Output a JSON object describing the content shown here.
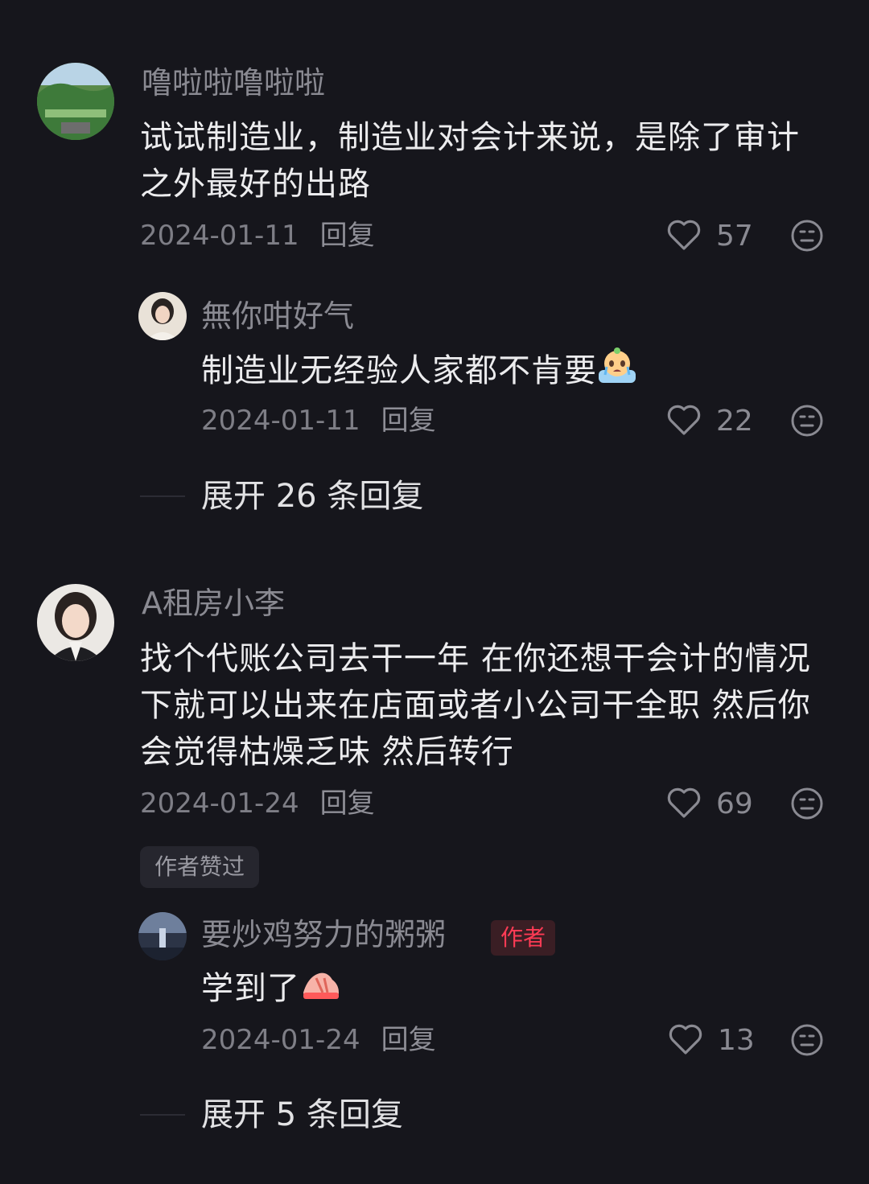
{
  "comments": [
    {
      "user": "噜啦啦噜啦啦",
      "text_line1": "试试制造业，制造业对会计来说，是除了审计",
      "text_line2": "之外最好的出路",
      "date": "2024-01-11",
      "reply_label": "回复",
      "likes": "57",
      "reply": {
        "user": "無你咁好气",
        "text": "制造业无经验人家都不肯要",
        "date": "2024-01-11",
        "reply_label": "回复",
        "likes": "22"
      },
      "expand": "展开 26 条回复"
    },
    {
      "user": "A租房小李",
      "text_line1": "找个代账公司去干一年 在你还想干会计的情况",
      "text_line2": "下就可以出来在店面或者小公司干全职 然后你",
      "text_line3": "会觉得枯燥乏味 然后转行",
      "date": "2024-01-24",
      "reply_label": "回复",
      "likes": "69",
      "author_liked": "作者赞过",
      "reply": {
        "user": "要炒鸡努力的粥粥",
        "badge": "作者",
        "text": "学到了",
        "date": "2024-01-24",
        "reply_label": "回复",
        "likes": "13"
      },
      "expand": "展开 5 条回复"
    }
  ],
  "colors": {
    "background": "#16161c",
    "author_badge": "#ff3b55"
  }
}
